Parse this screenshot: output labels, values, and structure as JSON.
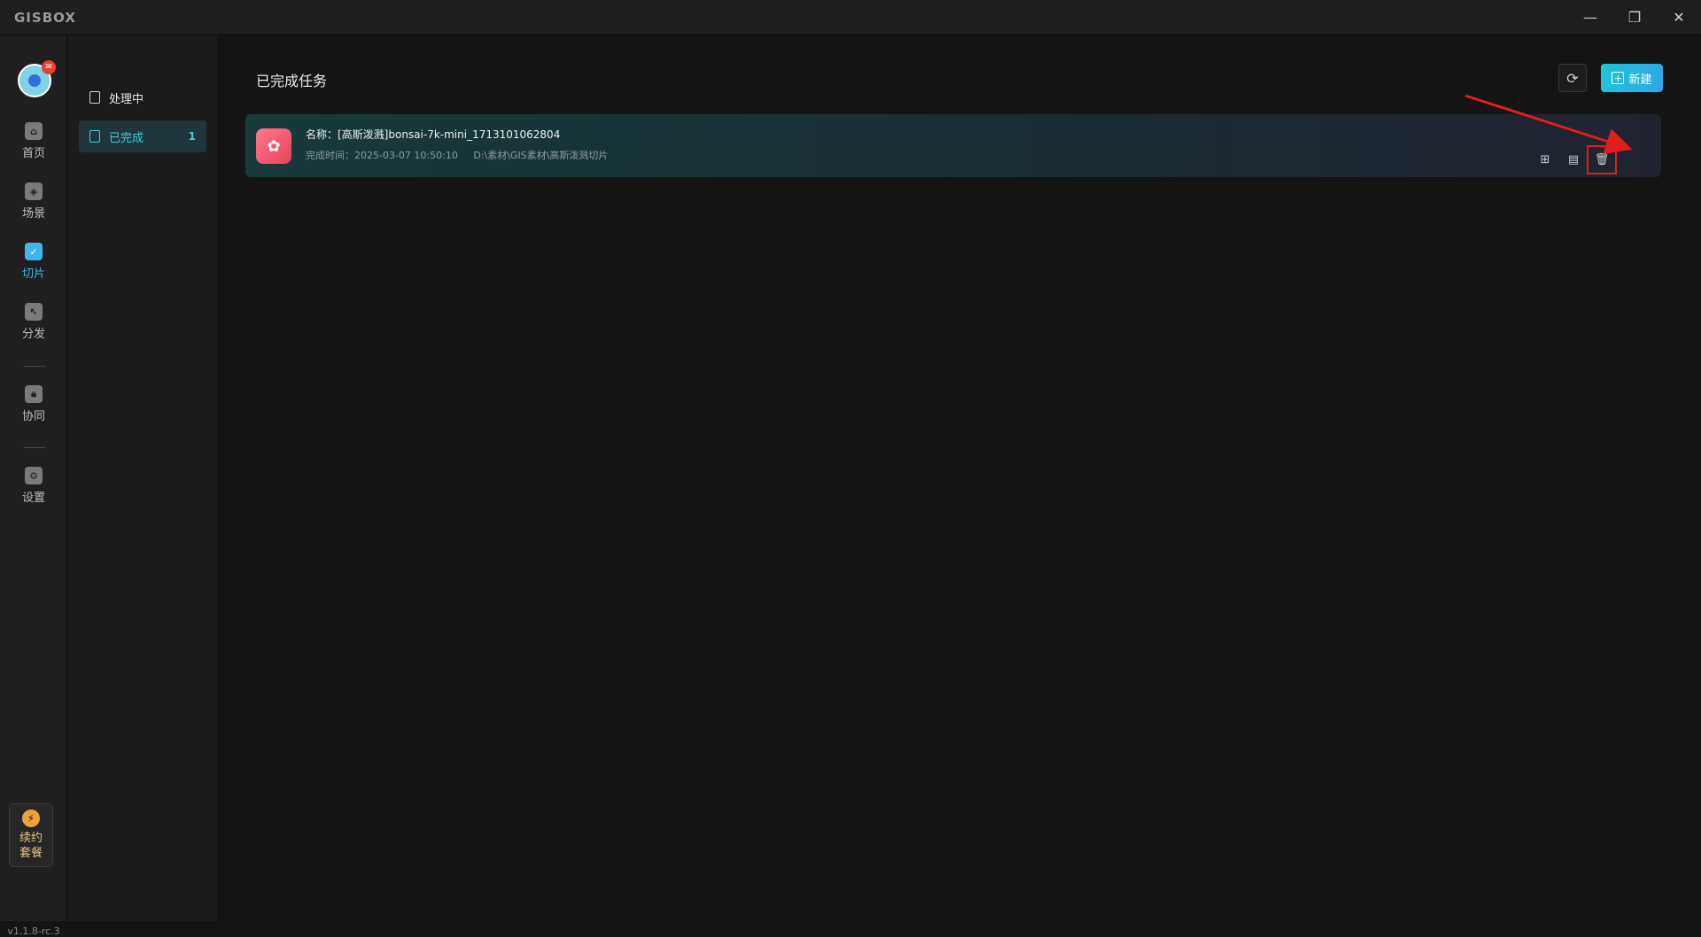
{
  "app": {
    "brand": "GISBOX",
    "window_controls": {
      "minimize": "—",
      "restore": "❐",
      "close": "✕"
    }
  },
  "nav": {
    "items": [
      {
        "label": "首页",
        "icon": "home-icon"
      },
      {
        "label": "场景",
        "icon": "scene-icon"
      },
      {
        "label": "切片",
        "icon": "slice-icon",
        "active": true
      },
      {
        "label": "分发",
        "icon": "distribute-icon"
      },
      {
        "label": "协同",
        "icon": "lock-icon"
      },
      {
        "label": "设置",
        "icon": "gear-icon"
      }
    ],
    "promo": {
      "line1": "续约",
      "line2": "套餐"
    },
    "version": "v1.1.8-rc.3"
  },
  "subnav": {
    "items": [
      {
        "label": "处理中"
      },
      {
        "label": "已完成",
        "count": "1",
        "active": true
      }
    ]
  },
  "main": {
    "title": "已完成任务",
    "new_label": "新建",
    "tasks": [
      {
        "name": "名称：[高斯泼溅]bonsai-7k-mini_1713101062804",
        "time": "完成时间：2025-03-07 10:50:10",
        "path": "D:\\素材\\GIS素材\\高斯泼溅切片"
      }
    ]
  },
  "colors": {
    "accent": "#3fd0d6",
    "highlight": "#e11d1d"
  }
}
